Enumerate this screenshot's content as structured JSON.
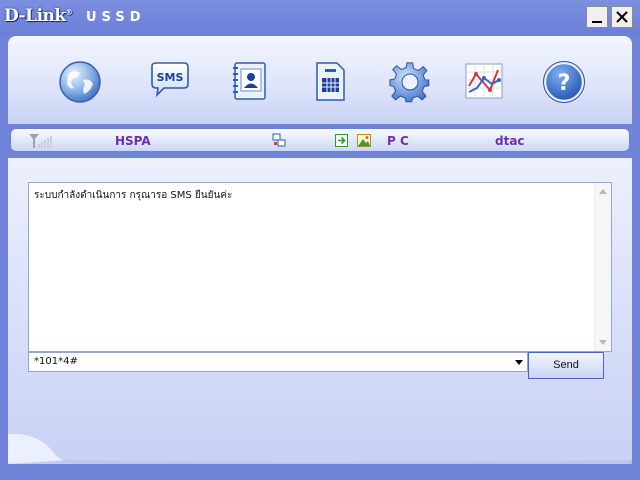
{
  "window": {
    "brand_logo": "D-Link",
    "brand_mark": "®",
    "title": "USSD",
    "minimize_icon": "minimize-icon",
    "close_icon": "close-icon"
  },
  "toolbar": {
    "items": [
      {
        "name": "internet",
        "icon": "globe-icon"
      },
      {
        "name": "sms",
        "icon": "sms-bubble-icon",
        "icon_text": "SMS"
      },
      {
        "name": "contacts",
        "icon": "phonebook-icon"
      },
      {
        "name": "sim",
        "icon": "sim-card-icon"
      },
      {
        "name": "settings",
        "icon": "gear-icon"
      },
      {
        "name": "statistics",
        "icon": "chart-icon"
      },
      {
        "name": "help",
        "icon": "help-icon",
        "icon_text": "?"
      }
    ]
  },
  "status_bar": {
    "signal_icon": "signal-strength-icon",
    "network_type": "HSPA",
    "connection_icon": "network-connection-icon",
    "pc_icons": [
      "sync-arrow-icon",
      "image-icon"
    ],
    "mode": "P C",
    "operator": "dtac"
  },
  "ussd": {
    "response_text": "ระบบกำลังดำเนินการ กรุณารอ SMS ยืนยันค่ะ",
    "code_value": "*101*4#",
    "send_label": "Send"
  },
  "colors": {
    "window_blue": "#6f84d8",
    "status_text": "#6a34b0",
    "panel_light": "#dfe5fa"
  }
}
